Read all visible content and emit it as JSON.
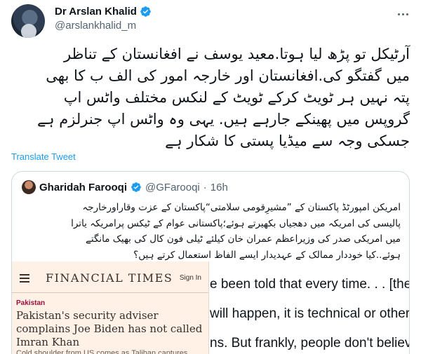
{
  "author": {
    "name": "Dr Arslan Khalid",
    "handle": "@arslankhalid_m"
  },
  "tweet": {
    "text_lines": [
      "آرٹیکل تو پڑھ لیا ہوتا.معید یوسف نے افغانستان کے تناظر",
      "میں گفتگو کی.افغانستان اور خارجہ امور کی الف ب کا بھی",
      "پتہ نہیں ہر ٹویٹ کرکے ٹویٹ کے لنکس مختلف واٹس اپ",
      "گروپس میں پھینکے جارہے ہیں. یہی وہ واٹس اپ جنرلزم ہے",
      "جسکی وجہ سے میڈیا پستی کا شکار ہے"
    ],
    "translate_label": "Translate Tweet"
  },
  "quote": {
    "name": "Gharidah Farooqi",
    "handle": "@GFarooqi",
    "separator": "·",
    "time": "16h",
    "text_lines": [
      "امریکن امپورٹڈ پاکستان کے ”مشیرِقومی سلامتی“پاکستان کے عزت وقاراورخارجہ",
      "پالیسی کی امریکہ میں دھجیاں بکھیرتے ہوئے؛پاکستانی عوام کے ٹیکس پرامریکہ یاترا",
      "میں امریکی صدر کی وزیراعظم عمران خان کیلئے ٹیلی فون کال کی بھیک مانگتے",
      "ہوئے..کیا خوددار ممالک کے عہدیدار ایسے الفاظ استعمال کرتے ہیں؟"
    ],
    "media": {
      "ft_logo": "FINANCIAL TIMES",
      "ft_signin": "Sign In",
      "ft_kicker": "Pakistan",
      "ft_headline": "Pakistan's security adviser complains Joe Biden has not called Imran Khan",
      "ft_standfirst": "Cold shoulder from US comes as Taliban captures swaths of territory across Afghanistan",
      "quote_lines": [
        "e been told that every time. . . [the",
        "will happen, it is technical or other",
        "ns. But frankly, people don't believ"
      ]
    }
  },
  "colors": {
    "link": "#1d9bf0",
    "verified": "#1d9bf0",
    "ft_background": "#fff1e5",
    "ft_kicker": "#990f3d"
  },
  "icons": {
    "verified": "verified-badge-icon",
    "more": "more-horizontal-icon",
    "ft_menu": "hamburger-menu-icon"
  }
}
